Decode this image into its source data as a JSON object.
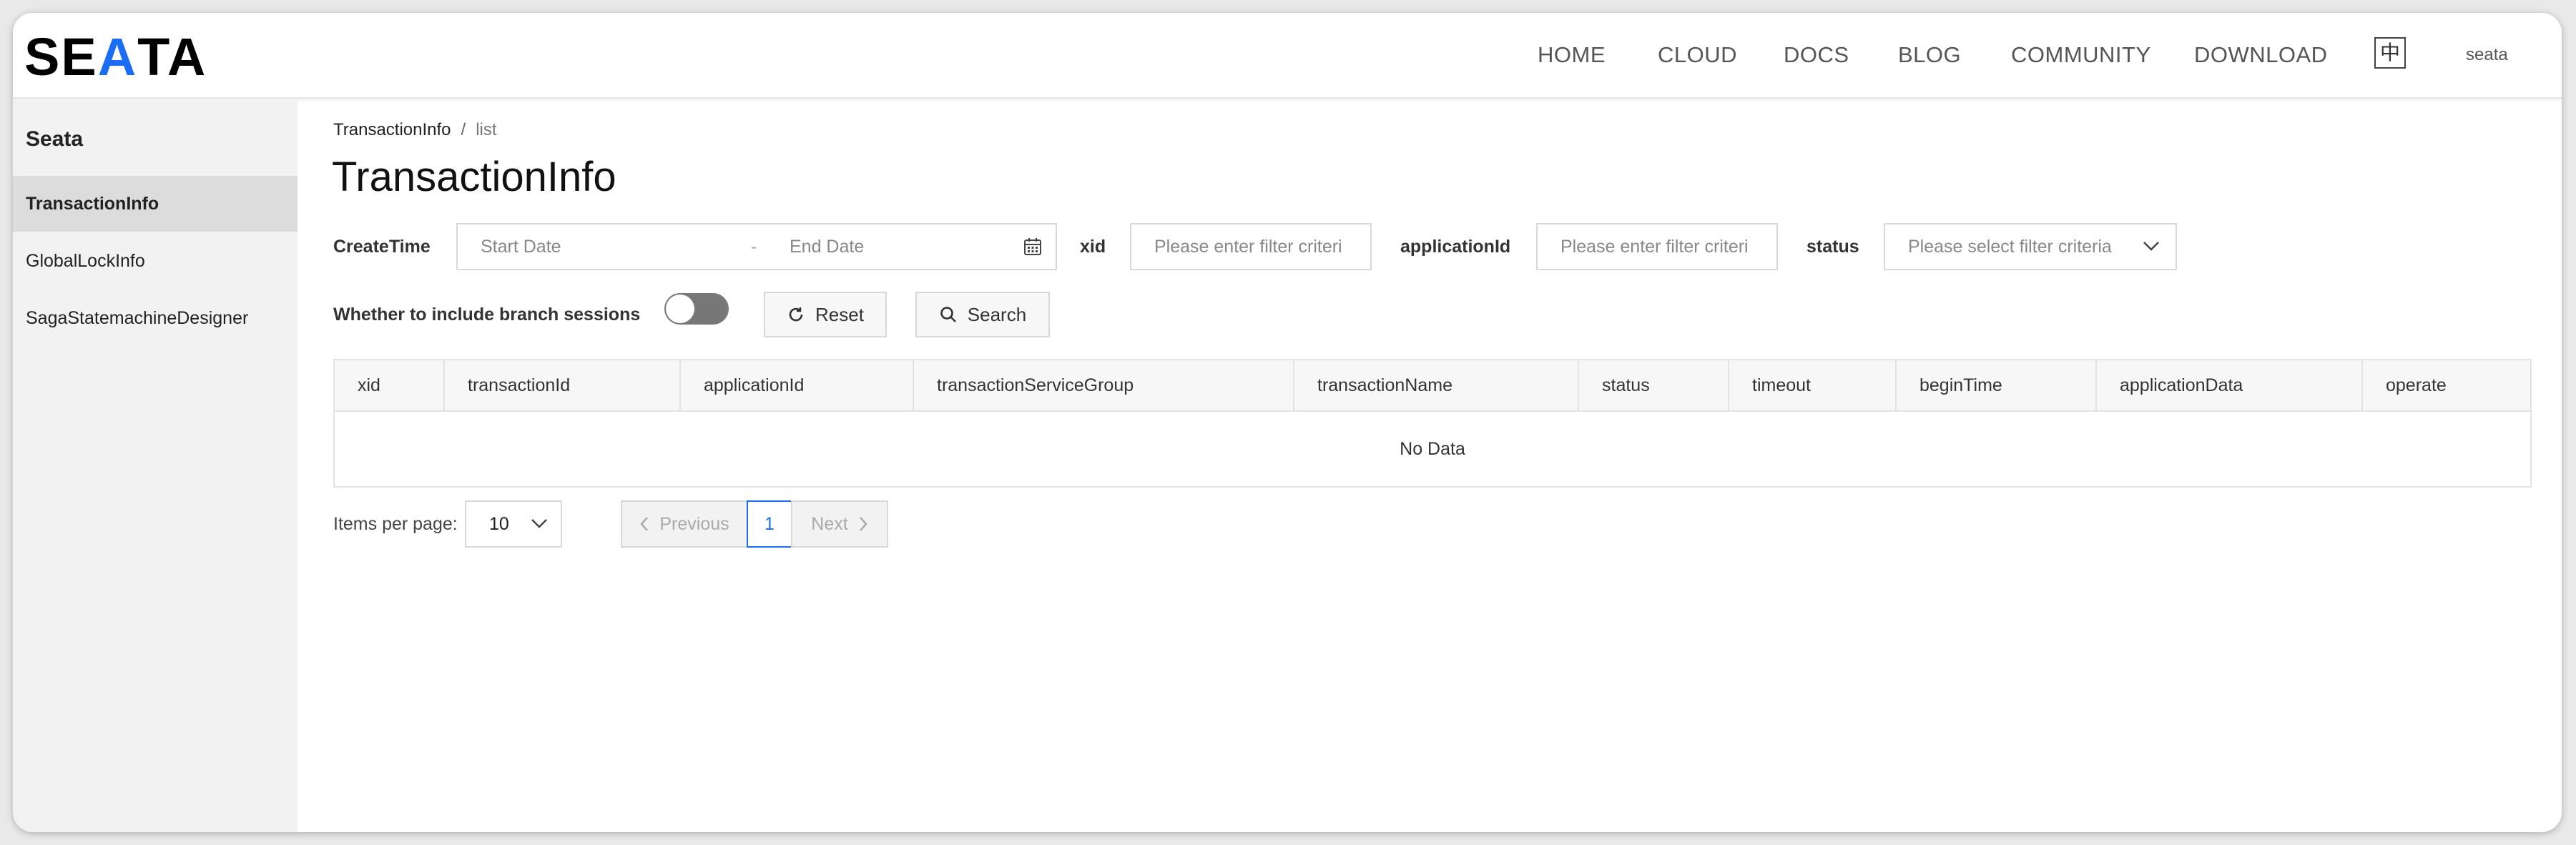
{
  "header": {
    "logo": {
      "pre": "SE",
      "accent": "A",
      "post": "TA"
    },
    "nav": [
      "HOME",
      "CLOUD",
      "DOCS",
      "BLOG",
      "COMMUNITY",
      "DOWNLOAD"
    ],
    "lang": "中",
    "user": "seata"
  },
  "sidebar": {
    "title": "Seata",
    "items": [
      {
        "label": "TransactionInfo"
      },
      {
        "label": "GlobalLockInfo"
      },
      {
        "label": "SagaStatemachineDesigner"
      }
    ]
  },
  "breadcrumb": {
    "root": "TransactionInfo",
    "sep": "/",
    "current": "list"
  },
  "page_title": "TransactionInfo",
  "filters": {
    "create_time_label": "CreateTime",
    "start_placeholder": "Start Date",
    "range_sep": "-",
    "end_placeholder": "End Date",
    "xid_label": "xid",
    "xid_placeholder": "Please enter filter criteri",
    "appid_label": "applicationId",
    "appid_placeholder": "Please enter filter criteri",
    "status_label": "status",
    "status_placeholder": "Please select filter criteria",
    "branch_label": "Whether to include branch sessions",
    "reset_label": "Reset",
    "search_label": "Search"
  },
  "table": {
    "columns": [
      "xid",
      "transactionId",
      "applicationId",
      "transactionServiceGroup",
      "transactionName",
      "status",
      "timeout",
      "beginTime",
      "applicationData",
      "operate"
    ],
    "empty_text": "No Data"
  },
  "pagination": {
    "items_per_page_label": "Items per page:",
    "page_size": "10",
    "prev_label": "Previous",
    "current_page": "1",
    "next_label": "Next"
  },
  "colors": {
    "accent": "#1b6ef3",
    "sidebar_bg": "#f2f2f2",
    "active_item_bg": "#dcdcdc"
  }
}
